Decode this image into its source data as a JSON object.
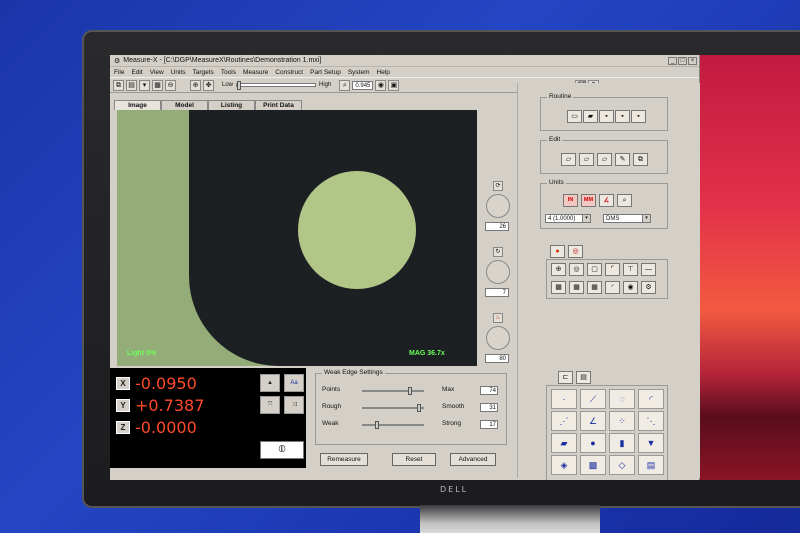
{
  "window": {
    "title": "Measure-X - [C:\\DGP\\MeasureX\\Routines\\Demonstration 1.mxi]",
    "controls": [
      "_",
      "□",
      "×"
    ]
  },
  "menu": [
    "File",
    "Edit",
    "View",
    "Units",
    "Targets",
    "Tools",
    "Measure",
    "Construct",
    "Part Setup",
    "System",
    "Help"
  ],
  "toolbar": {
    "light_low": "Low",
    "light_high": "High",
    "zoom_value": "0.945",
    "light_level": 0.0
  },
  "tabs": [
    "Image",
    "Model",
    "Listing",
    "Print Data"
  ],
  "camera": {
    "light_label": "Light  0%",
    "mag_label": "MAG 36.7x"
  },
  "dials": [
    {
      "value": "26"
    },
    {
      "value": "7"
    },
    {
      "value": "80"
    }
  ],
  "readout": {
    "x_label": "X",
    "y_label": "Y",
    "z_label": "Z",
    "x_value": "-0.0950",
    "y_value": "+0.7387",
    "z_value": "-0.0000",
    "datum_symbol": "⦶"
  },
  "edge_settings": {
    "title": "Weak Edge Settings",
    "rows": [
      {
        "left": "Points",
        "right": "Max",
        "value": "74",
        "level": 0.8
      },
      {
        "left": "Rough",
        "right": "Smooth",
        "value": "31",
        "level": 0.95
      },
      {
        "left": "Weak",
        "right": "Strong",
        "value": "17",
        "level": 0.22
      }
    ],
    "buttons": [
      "Remeasure",
      "Reset",
      "Advanced"
    ]
  },
  "right_panel": {
    "routine_title": "Routine",
    "edit_title": "Edit",
    "units_title": "Units",
    "units_in": "IN",
    "units_mm": "MM",
    "units_select_1": "4 (1.0000)",
    "units_select_2": "DMS"
  },
  "brand": "DELL"
}
